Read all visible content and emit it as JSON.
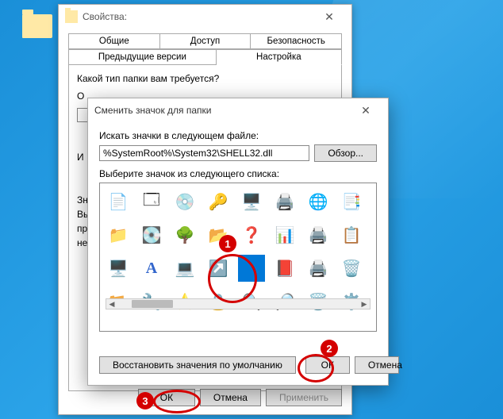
{
  "props_window": {
    "title": "Свойства:",
    "tabs_row1": [
      "Общие",
      "Доступ",
      "Безопасность"
    ],
    "tabs_row2": [
      "Предыдущие версии",
      "Настройка"
    ],
    "active_tab": "Настройка",
    "question": "Какой тип папки вам требуется?",
    "line1": "О",
    "line2": "И",
    "line3": "Зн",
    "line4": "Вы",
    "line5": "пр",
    "line6": "не",
    "ok": "ОК",
    "cancel": "Отмена",
    "apply": "Применить"
  },
  "icon_dialog": {
    "title": "Сменить значок для папки",
    "search_label": "Искать значки в следующем файле:",
    "path_value": "%SystemRoot%\\System32\\SHELL32.dll",
    "browse": "Обзор...",
    "pick_label": "Выберите значок из следующего списка:",
    "restore": "Восстановить значения по умолчанию",
    "ok": "ОК",
    "cancel": "Отмена"
  },
  "annotations": {
    "n1": "1",
    "n2": "2",
    "n3": "3"
  }
}
